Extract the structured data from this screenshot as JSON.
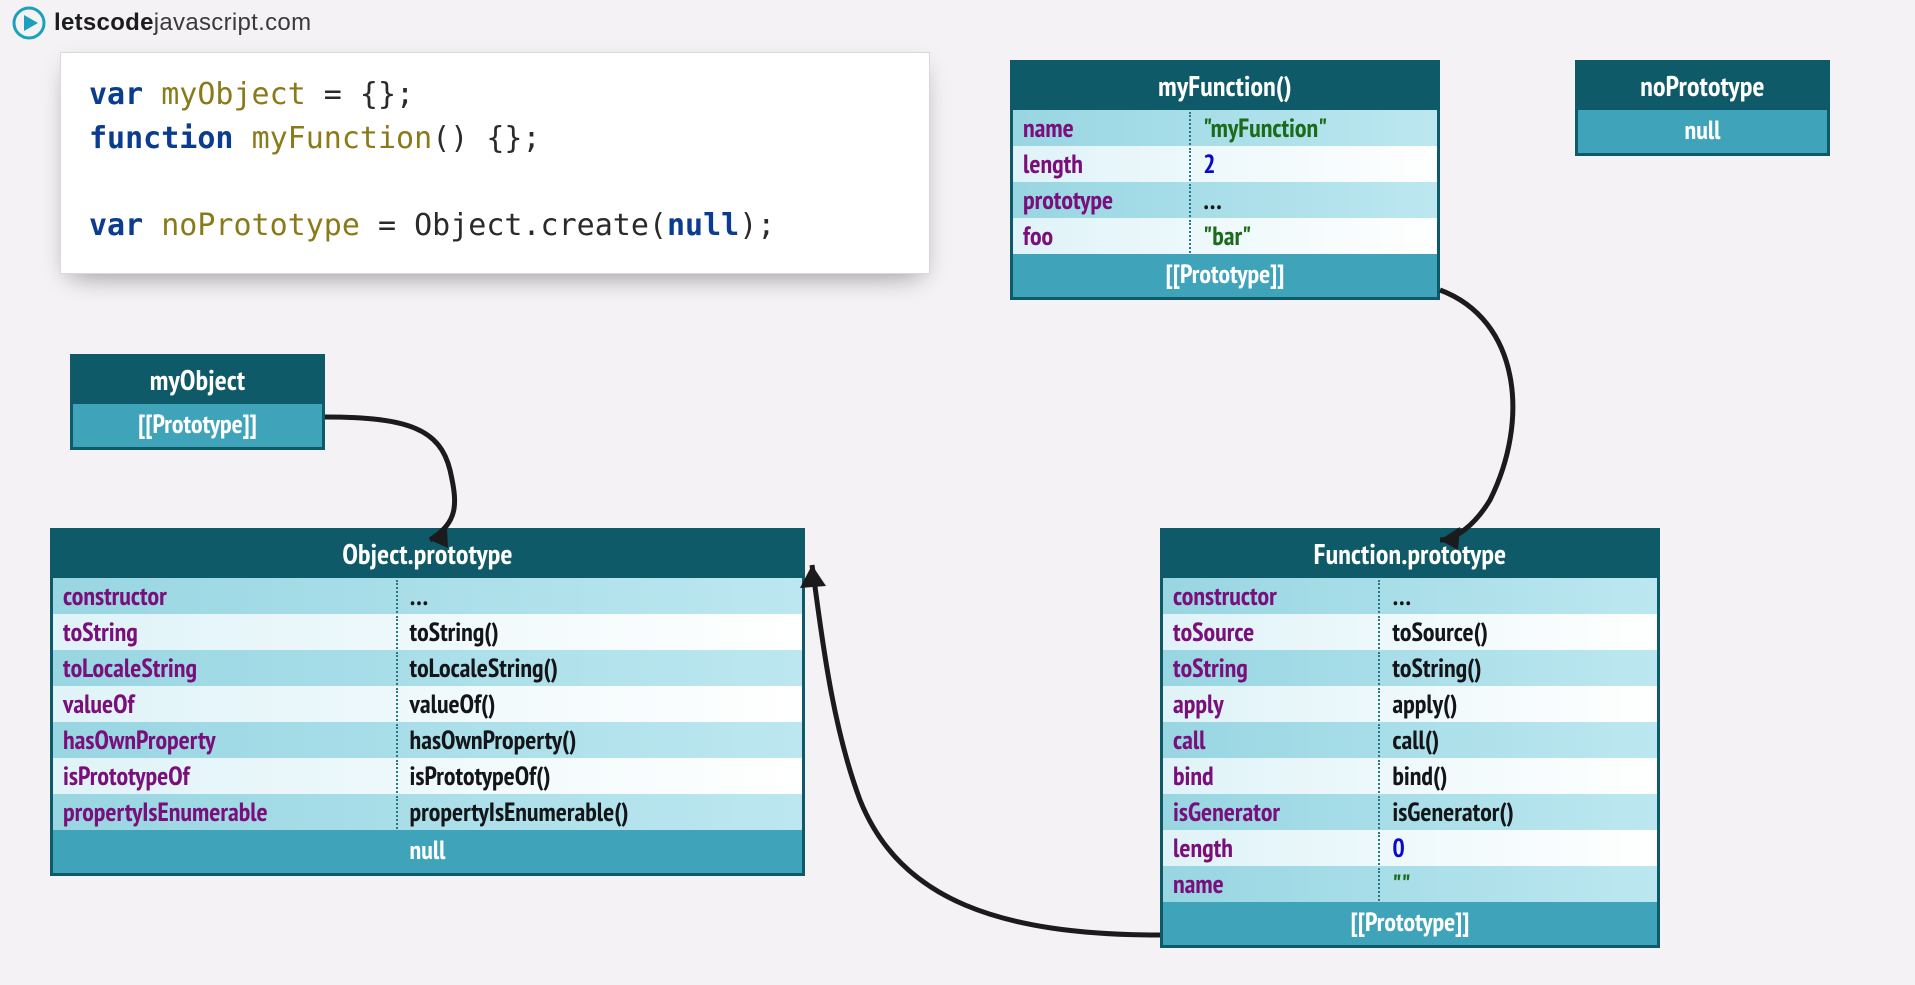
{
  "logo": {
    "bold": "letscode",
    "rest": "javascript.com"
  },
  "code": {
    "line1_kw": "var",
    "line1_id": "myObject",
    "line1_tail": " = {};",
    "line2_kw": "function",
    "line2_id": "myFunction",
    "line2_tail": "() {};",
    "line3_kw": "var",
    "line3_id": "noPrototype",
    "line3_mid": " = Object.create(",
    "line3_null": "null",
    "line3_end": ");"
  },
  "boxes": {
    "myFunction": {
      "title": "myFunction()",
      "rows": [
        {
          "key": "name",
          "val": "\"myFunction\"",
          "valClass": "val-string"
        },
        {
          "key": "length",
          "val": "2",
          "valClass": "val-num"
        },
        {
          "key": "prototype",
          "val": "…",
          "valClass": ""
        },
        {
          "key": "foo",
          "val": "\"bar\"",
          "valClass": "val-string"
        }
      ],
      "footer": "[[Prototype]]"
    },
    "noPrototype": {
      "title": "noPrototype",
      "footer": "null"
    },
    "myObject": {
      "title": "myObject",
      "footer": "[[Prototype]]"
    },
    "objectProto": {
      "title": "Object.prototype",
      "rows": [
        {
          "key": "constructor",
          "val": "…"
        },
        {
          "key": "toString",
          "val": "toString()"
        },
        {
          "key": "toLocaleString",
          "val": "toLocaleString()"
        },
        {
          "key": "valueOf",
          "val": "valueOf()"
        },
        {
          "key": "hasOwnProperty",
          "val": "hasOwnProperty()"
        },
        {
          "key": "isPrototypeOf",
          "val": "isPrototypeOf()"
        },
        {
          "key": "propertyIsEnumerable",
          "val": "propertyIsEnumerable()"
        }
      ],
      "footer": "null"
    },
    "functionProto": {
      "title": "Function.prototype",
      "rows": [
        {
          "key": "constructor",
          "val": "…"
        },
        {
          "key": "toSource",
          "val": "toSource()"
        },
        {
          "key": "toString",
          "val": "toString()"
        },
        {
          "key": "apply",
          "val": "apply()"
        },
        {
          "key": "call",
          "val": "call()"
        },
        {
          "key": "bind",
          "val": "bind()"
        },
        {
          "key": "isGenerator",
          "val": "isGenerator()"
        },
        {
          "key": "length",
          "val": "0",
          "valClass": "val-num"
        },
        {
          "key": "name",
          "val": "\"\"",
          "valClass": "val-string"
        }
      ],
      "footer": "[[Prototype]]"
    }
  }
}
